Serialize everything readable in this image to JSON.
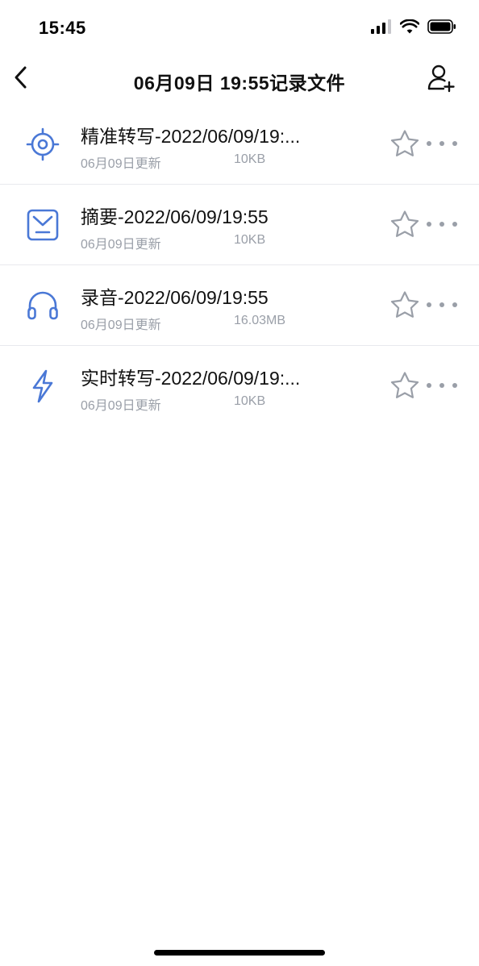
{
  "status_bar": {
    "time": "15:45"
  },
  "header": {
    "title": "06月09日 19:55记录文件"
  },
  "files": [
    {
      "name": "精准转写-2022/06/09/19:...",
      "updated": "06月09日更新",
      "size": "10KB",
      "icon": "target-icon"
    },
    {
      "name": "摘要-2022/06/09/19:55",
      "updated": "06月09日更新",
      "size": "10KB",
      "icon": "inbox-icon"
    },
    {
      "name": "录音-2022/06/09/19:55",
      "updated": "06月09日更新",
      "size": "16.03MB",
      "icon": "headphones-icon"
    },
    {
      "name": "实时转写-2022/06/09/19:...",
      "updated": "06月09日更新",
      "size": "10KB",
      "icon": "lightning-icon"
    }
  ],
  "colors": {
    "accent": "#4a78d6",
    "muted": "#9a9fa8",
    "divider": "#e8e9ee"
  }
}
